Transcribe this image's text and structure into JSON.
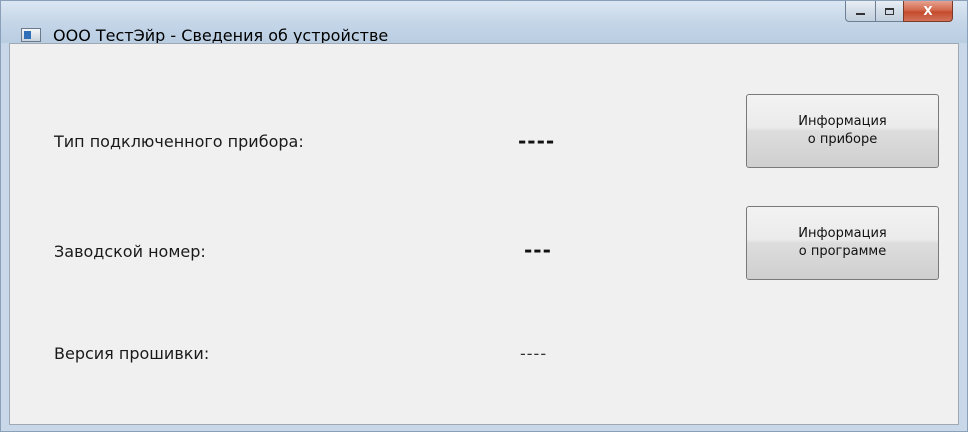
{
  "window": {
    "title": "ООО ТестЭйр - Сведения об устройстве",
    "close_glyph": "X"
  },
  "fields": {
    "device_type_label": "Тип подключенного прибора:",
    "device_type_value": "----",
    "serial_label": "Заводской номер:",
    "serial_value": "---",
    "firmware_label": "Версия прошивки:",
    "firmware_value": "----"
  },
  "buttons": {
    "device_info_line1": "Информация",
    "device_info_line2": "о приборе",
    "program_info_line1": "Информация",
    "program_info_line2": "о программе"
  }
}
